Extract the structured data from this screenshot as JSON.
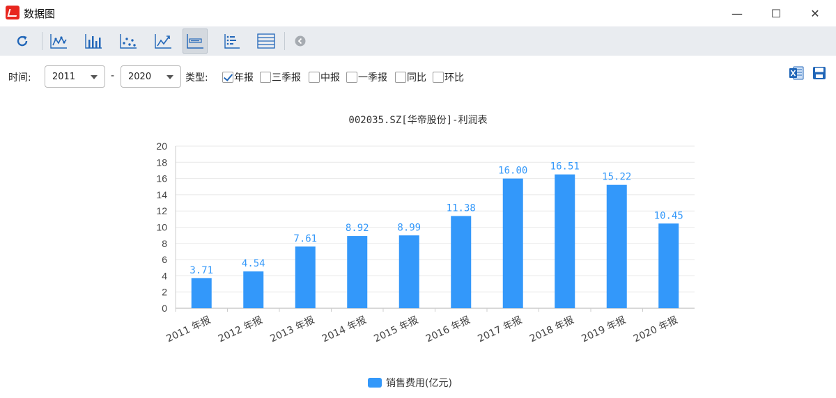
{
  "window": {
    "title": "数据图",
    "minimize_glyph": "—",
    "maximize_glyph": "☐",
    "close_glyph": "✕"
  },
  "toolbar": {
    "buttons": [
      {
        "name": "refresh-icon"
      },
      {
        "name": "line-chart-icon"
      },
      {
        "name": "bar-chart-icon"
      },
      {
        "name": "scatter-chart-icon"
      },
      {
        "name": "trend-chart-icon"
      },
      {
        "name": "horizontal-chart-icon",
        "active": true
      },
      {
        "name": "dot-list-icon"
      },
      {
        "name": "table-view-icon"
      },
      {
        "name": "collapse-icon"
      }
    ]
  },
  "filters": {
    "time_label": "时间:",
    "start_year": "2011",
    "range_sep": "-",
    "end_year": "2020",
    "type_label": "类型:",
    "types": [
      {
        "label": "年报",
        "checked": true
      },
      {
        "label": "三季报",
        "checked": false
      },
      {
        "label": "中报",
        "checked": false
      },
      {
        "label": "一季报",
        "checked": false
      },
      {
        "label": "同比",
        "checked": false
      },
      {
        "label": "环比",
        "checked": false
      }
    ]
  },
  "actions": {
    "excel_icon": "excel-export-icon",
    "save_icon": "save-icon"
  },
  "colors": {
    "bar": "#3398fa",
    "label": "#3398fa",
    "axis": "#cccccc",
    "grid": "#e8e8e8"
  },
  "chart_data": {
    "type": "bar",
    "title": "002035.SZ[华帝股份]-利润表",
    "categories": [
      "2011 年报",
      "2012 年报",
      "2013 年报",
      "2014 年报",
      "2015 年报",
      "2016 年报",
      "2017 年报",
      "2018 年报",
      "2019 年报",
      "2020 年报"
    ],
    "series": [
      {
        "name": "销售费用(亿元)",
        "values": [
          3.71,
          4.54,
          7.61,
          8.92,
          8.99,
          11.38,
          16.0,
          16.51,
          15.22,
          10.45
        ]
      }
    ],
    "data_labels": [
      "3.71",
      "4.54",
      "7.61",
      "8.92",
      "8.99",
      "11.38",
      "16.00",
      "16.51",
      "15.22",
      "10.45"
    ],
    "ylim": [
      0,
      20
    ],
    "yticks": [
      "0",
      "2",
      "4",
      "6",
      "8",
      "10",
      "12",
      "14",
      "16",
      "18",
      "20"
    ],
    "grid": true,
    "legend": "bottom-center"
  }
}
